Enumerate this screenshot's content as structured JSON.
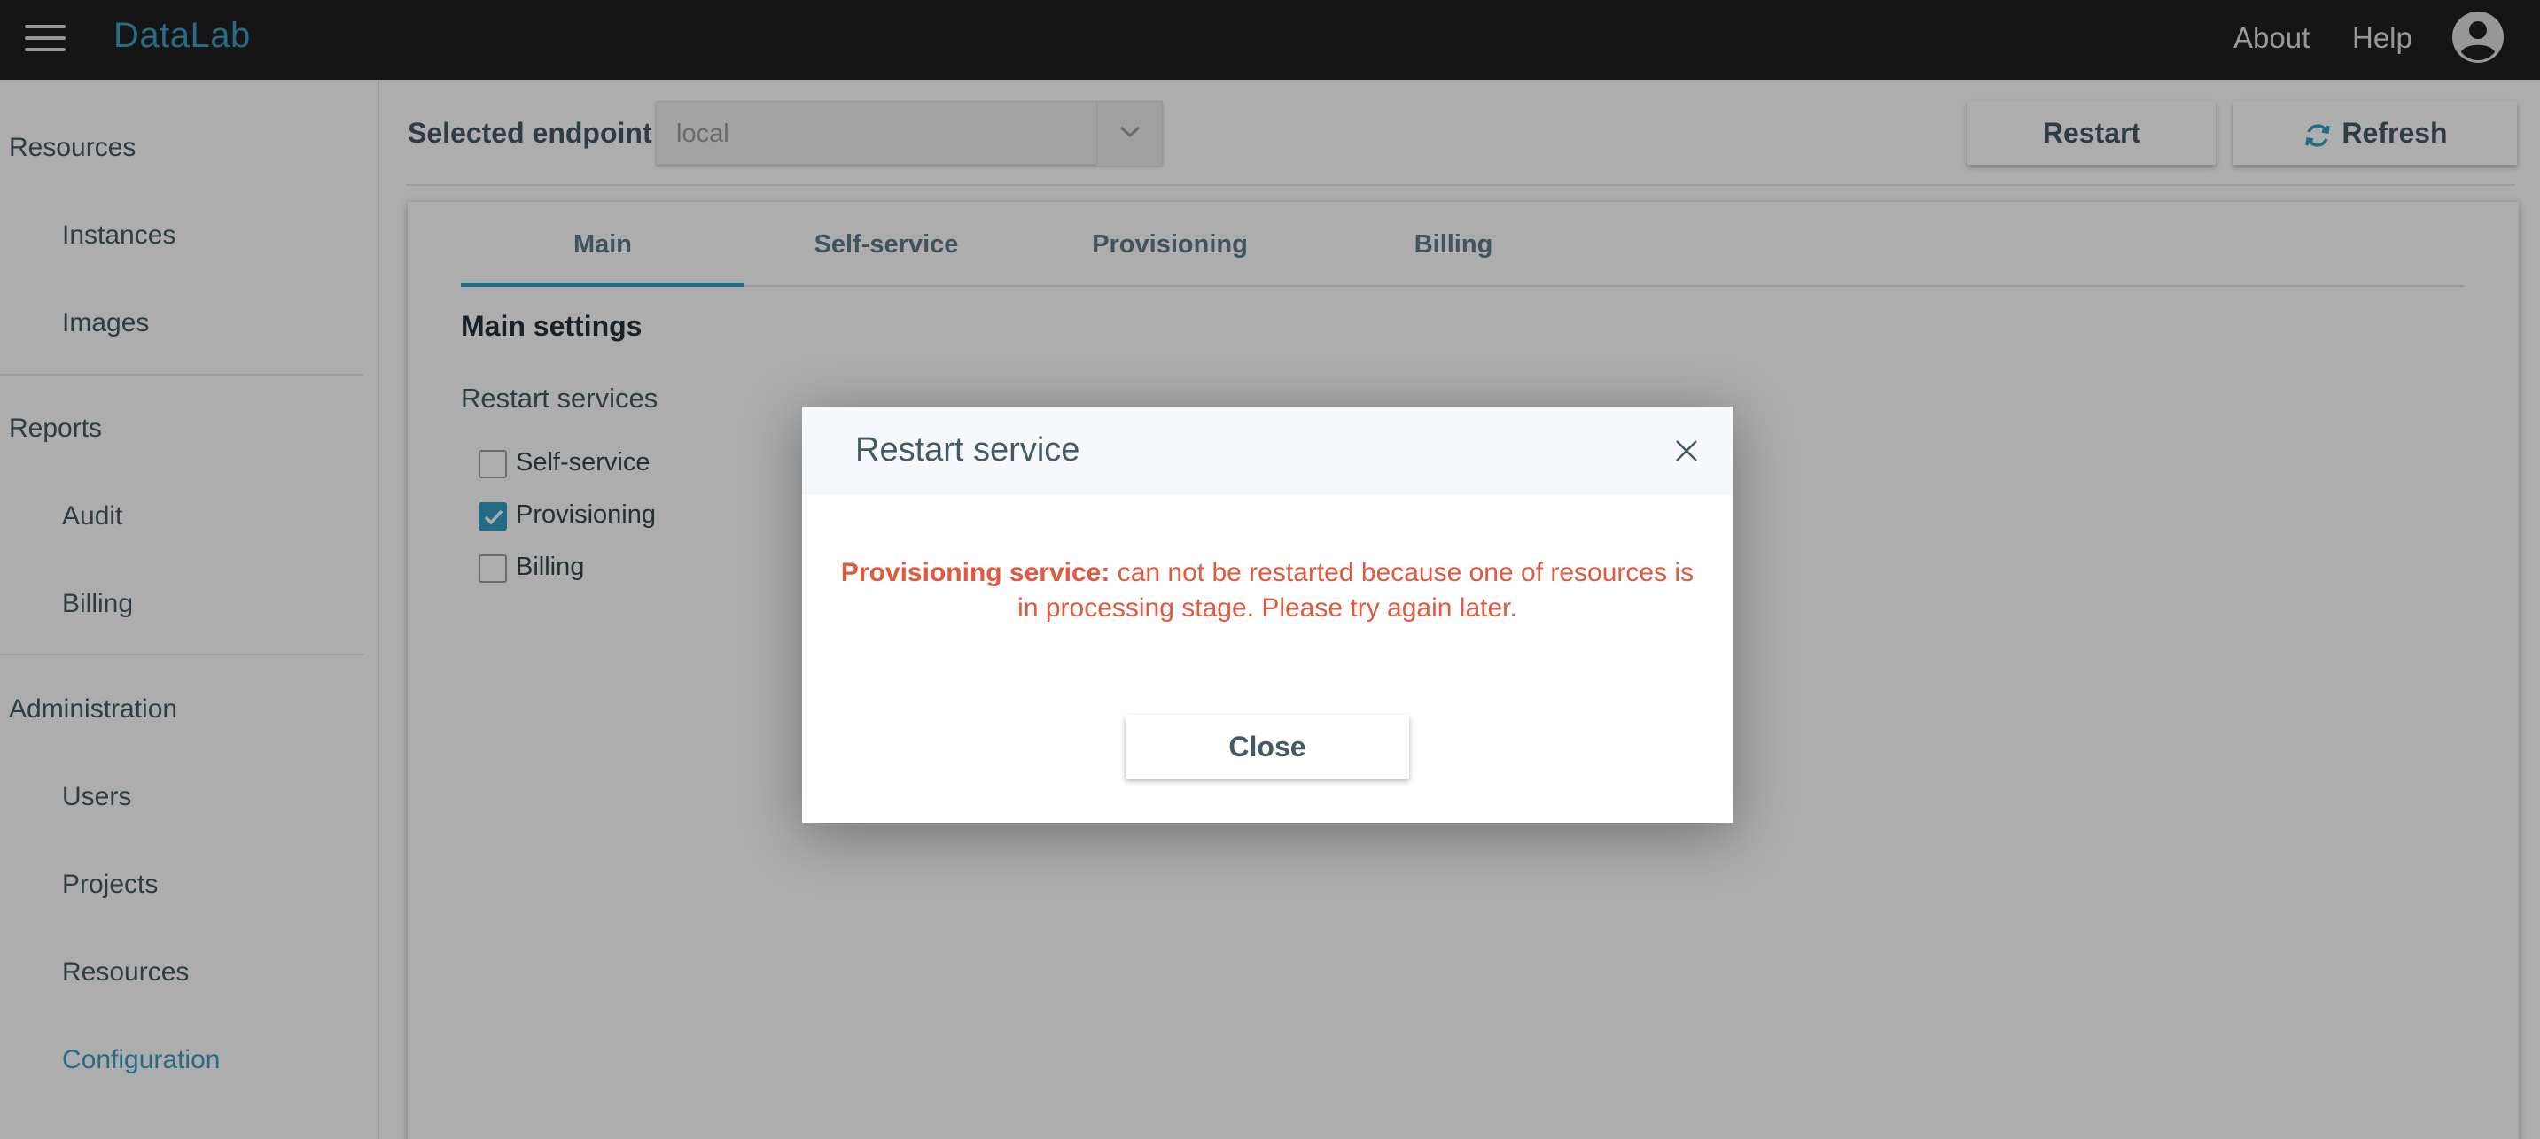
{
  "header": {
    "logo": "DataLab",
    "about_label": "About",
    "help_label": "Help"
  },
  "sidebar": {
    "groups": [
      {
        "label": "Resources",
        "items": [
          {
            "label": "Instances"
          },
          {
            "label": "Images"
          }
        ]
      },
      {
        "label": "Reports",
        "items": [
          {
            "label": "Audit"
          },
          {
            "label": "Billing"
          }
        ]
      },
      {
        "label": "Administration",
        "items": [
          {
            "label": "Users"
          },
          {
            "label": "Projects"
          },
          {
            "label": "Resources"
          },
          {
            "label": "Configuration",
            "active": true
          }
        ]
      }
    ]
  },
  "toolbar": {
    "endpoint_label": "Selected endpoint",
    "endpoint_value": "local",
    "restart_label": "Restart",
    "refresh_label": "Refresh"
  },
  "tabs": [
    {
      "label": "Main",
      "active": true
    },
    {
      "label": "Self-service"
    },
    {
      "label": "Provisioning"
    },
    {
      "label": "Billing"
    }
  ],
  "main_settings": {
    "title": "Main settings",
    "restart_services_label": "Restart services",
    "services": [
      {
        "label": "Self-service",
        "checked": false
      },
      {
        "label": "Provisioning",
        "checked": true
      },
      {
        "label": "Billing",
        "checked": false
      }
    ]
  },
  "dialog": {
    "title": "Restart service",
    "message_strong": "Provisioning service:",
    "message_line1": " can not be restarted because one of resources is",
    "message_line2": "in processing stage. Please try again later.",
    "close_label": "Close"
  },
  "colors": {
    "accent": "#35a0c5",
    "error": "#e05a3f",
    "topbar": "#1f1f1f"
  }
}
